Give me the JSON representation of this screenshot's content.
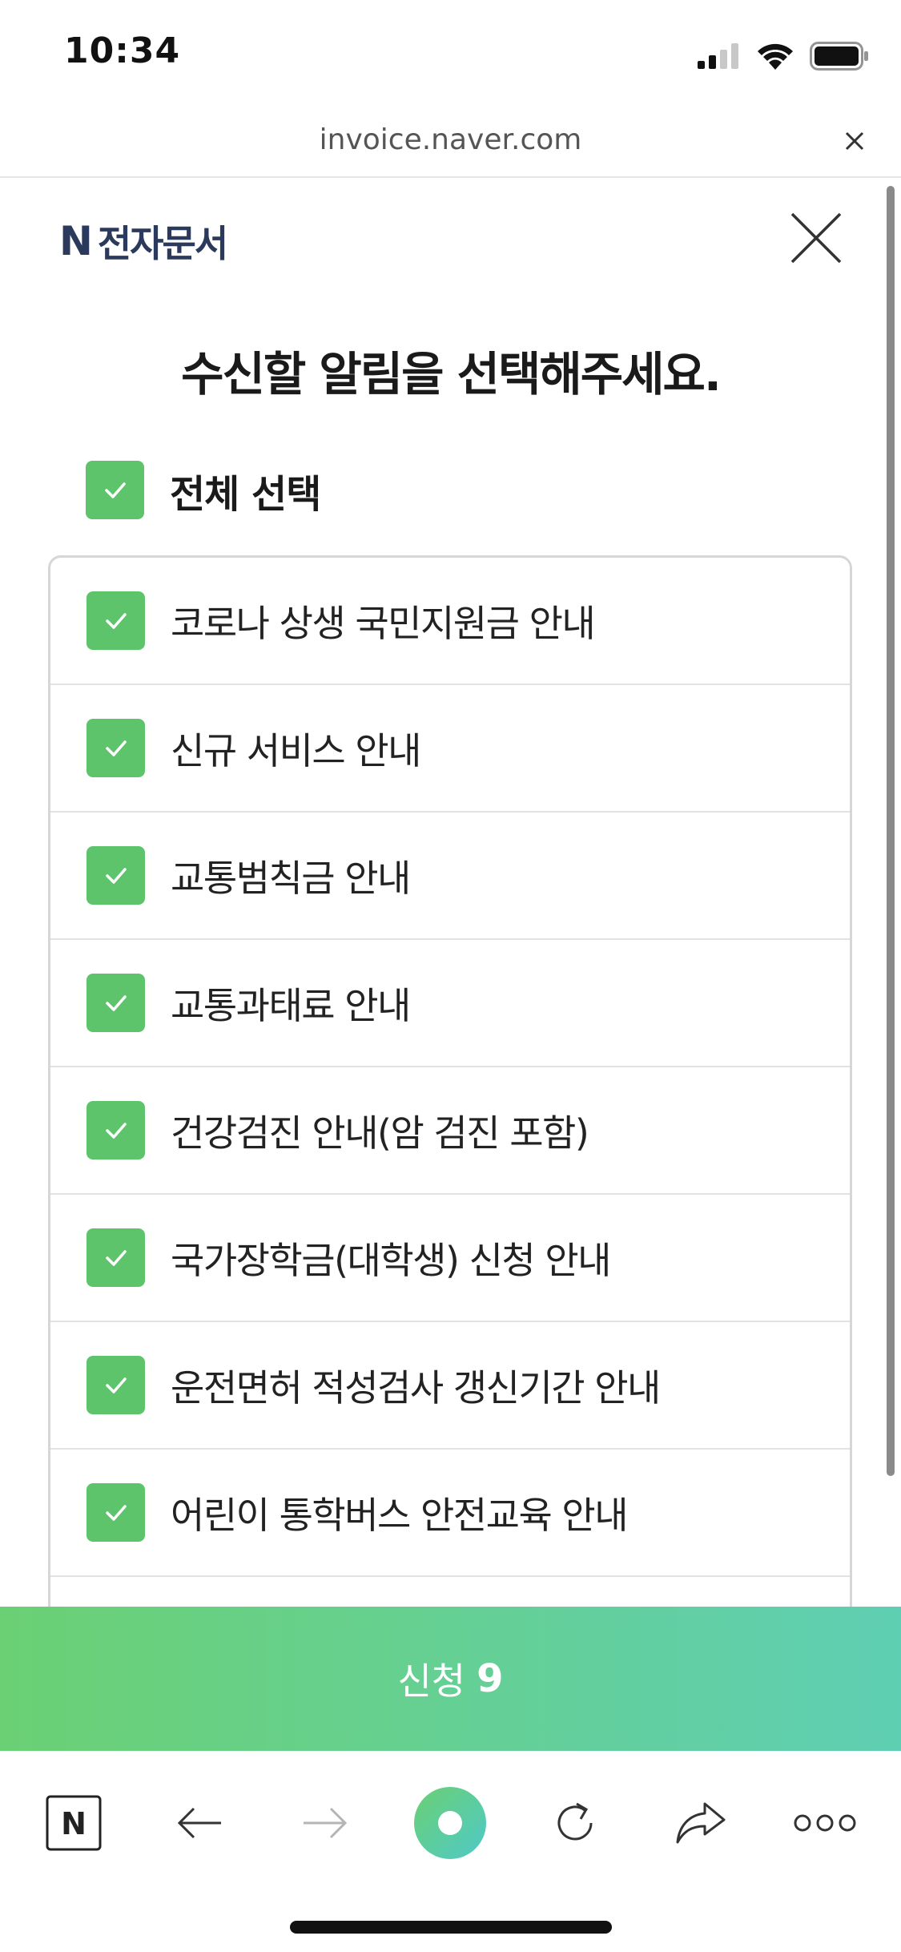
{
  "status_bar": {
    "time": "10:34"
  },
  "url_bar": {
    "url": "invoice.naver.com"
  },
  "header": {
    "logo_text": "N",
    "brand_name": "전자문서"
  },
  "title": "수신할 알림을 선택해주세요.",
  "select_all": {
    "label": "전체 선택",
    "checked": true
  },
  "items": [
    {
      "label": "코로나 상생 국민지원금 안내",
      "checked": true
    },
    {
      "label": "신규 서비스 안내",
      "checked": true
    },
    {
      "label": "교통범칙금 안내",
      "checked": true
    },
    {
      "label": "교통과태료 안내",
      "checked": true
    },
    {
      "label": "건강검진 안내(암 검진 포함)",
      "checked": true
    },
    {
      "label": "국가장학금(대학생) 신청 안내",
      "checked": true
    },
    {
      "label": "운전면허 적성검사 갱신기간 안내",
      "checked": true
    },
    {
      "label": "어린이 통학버스 안전교육 안내",
      "checked": true
    }
  ],
  "apply_button": {
    "label": "신청",
    "count": "9"
  },
  "toolbar": {
    "home_logo": "N"
  },
  "colors": {
    "check_green": "#5dc46c",
    "button_gradient_start": "#6bd074",
    "button_gradient_end": "#5fcfb3",
    "brand_navy": "#2b3a5c"
  }
}
